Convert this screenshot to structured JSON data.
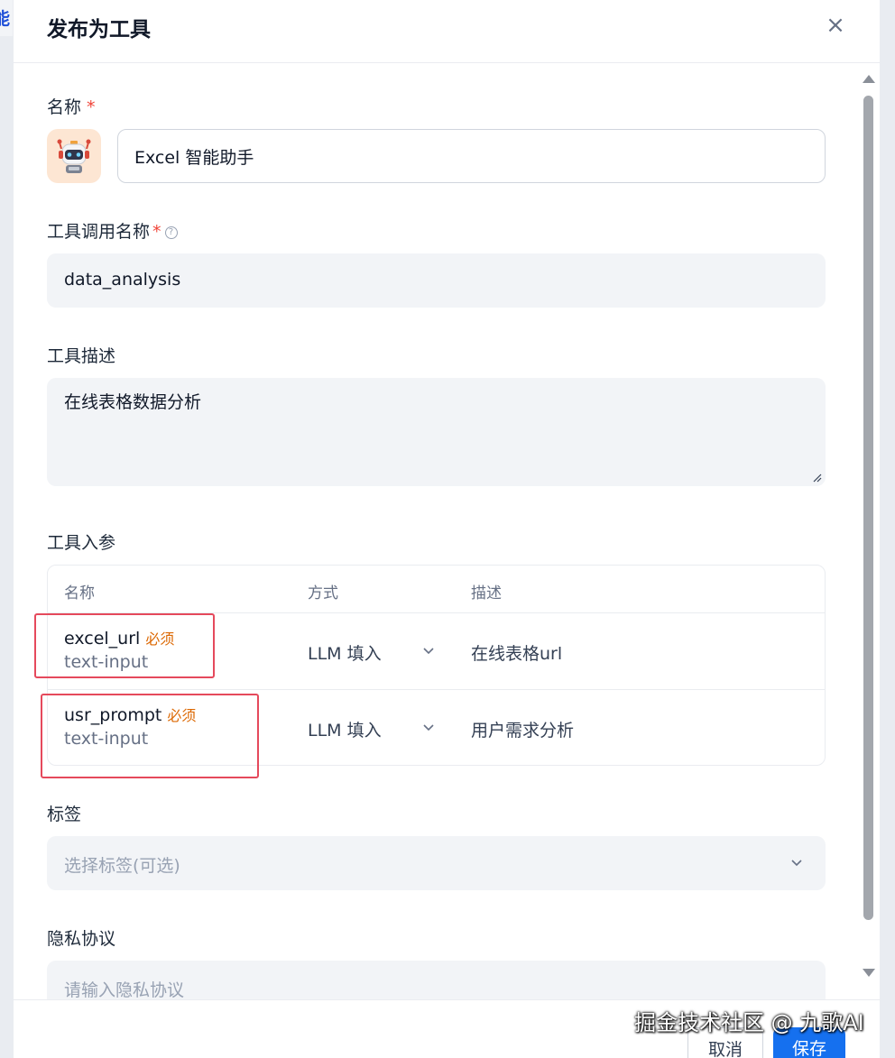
{
  "background": {
    "partial_tab_text": "能"
  },
  "dialog": {
    "title": "发布为工具",
    "close_icon": "close-icon",
    "required_mark": "*"
  },
  "form": {
    "name": {
      "label": "名称",
      "value": "Excel 智能助手",
      "avatar_icon": "robot-avatar-icon"
    },
    "call_name": {
      "label": "工具调用名称",
      "value": "data_analysis",
      "help_icon": "question-circle-icon"
    },
    "description": {
      "label": "工具描述",
      "value": "在线表格数据分析"
    },
    "params": {
      "label": "工具入参",
      "columns": [
        "名称",
        "方式",
        "描述"
      ],
      "rows": [
        {
          "name": "excel_url",
          "required": "必须",
          "type": "text-input",
          "method": "LLM 填入",
          "desc": "在线表格url"
        },
        {
          "name": "usr_prompt",
          "required": "必须",
          "type": "text-input",
          "method": "LLM 填入",
          "desc": "用户需求分析"
        }
      ]
    },
    "tags": {
      "label": "标签",
      "placeholder": "选择标签(可选)"
    },
    "privacy": {
      "label": "隐私协议",
      "placeholder": "请输入隐私协议"
    }
  },
  "footer": {
    "cancel_label": "取消",
    "save_label": "保存"
  },
  "watermark": "掘金技术社区 @ 九歌AI",
  "colors": {
    "primary": "#1570ef",
    "required": "#f04438",
    "required_tag": "#dc6803",
    "highlight_box": "#e5495c"
  }
}
